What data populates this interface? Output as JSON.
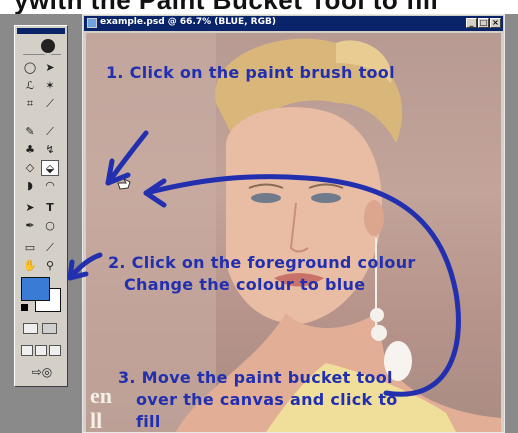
{
  "header_fragment": "ywith the Paint Bucket Tool to fill",
  "window": {
    "title": "example.psd @ 66.7% (BLUE, RGB)",
    "buttons": {
      "minimize": "_",
      "maximize": "□",
      "close": "×"
    }
  },
  "annotations": {
    "step1": "1. Click on the paint brush tool",
    "step2_line1": "2. Click on the foreground colour",
    "step2_line2": "Change the colour to blue",
    "step3_line1": "3. Move the paint bucket tool",
    "step3_line2": "over the canvas and click to",
    "step3_line3": "fill"
  },
  "canvas_text": {
    "line1": "en",
    "line2": "ll"
  },
  "colors": {
    "foreground": "#3a7bd5",
    "background": "#ffffff",
    "annotation": "#2230b0"
  },
  "tools": [
    "marquee-tool",
    "move-tool",
    "lasso-tool",
    "magic-wand-tool",
    "crop-tool",
    "slice-tool",
    "healing-brush-tool",
    "brush-tool",
    "clone-stamp-tool",
    "history-brush-tool",
    "eraser-tool",
    "paint-bucket-tool",
    "blur-tool",
    "dodge-tool",
    "path-selection-tool",
    "type-tool",
    "pen-tool",
    "shape-tool",
    "notes-tool",
    "eyedropper-tool",
    "hand-tool",
    "zoom-tool"
  ]
}
